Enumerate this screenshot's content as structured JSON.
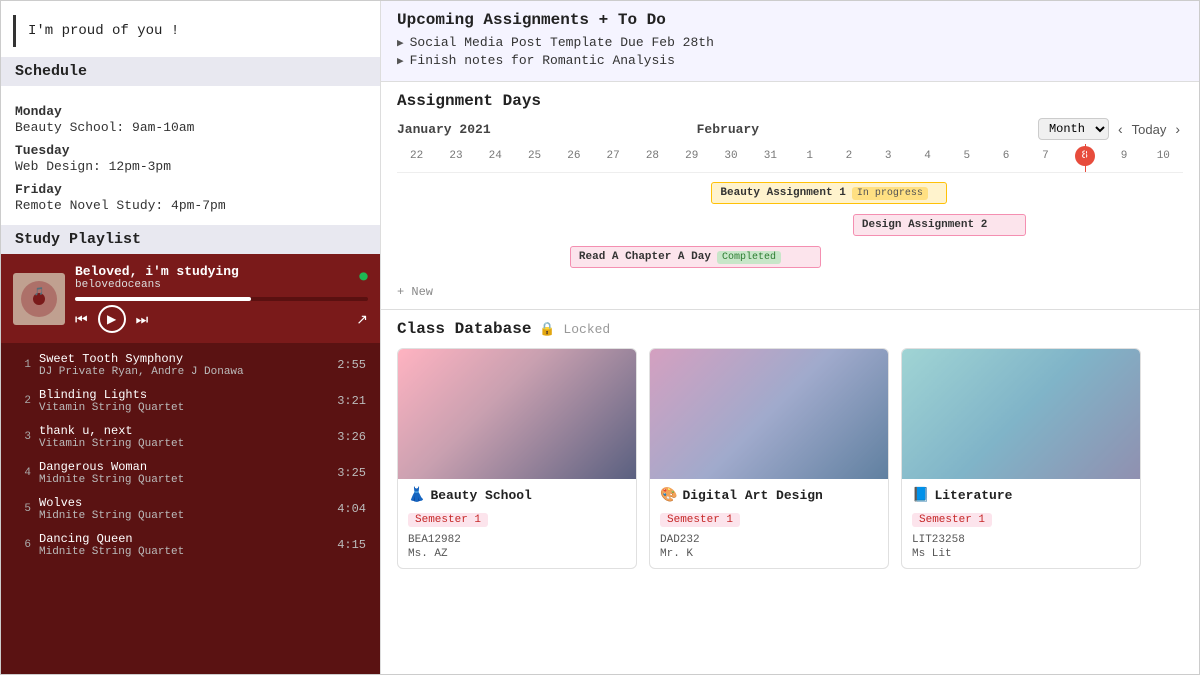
{
  "quote": "I'm proud of you !",
  "left": {
    "schedule_header": "Schedule",
    "schedule_days": [
      {
        "day": "Monday",
        "classes": [
          "Beauty School: 9am-10am"
        ]
      },
      {
        "day": "Tuesday",
        "classes": [
          "Web Design: 12pm-3pm"
        ]
      },
      {
        "day": "Friday",
        "classes": [
          "Remote Novel Study: 4pm-7pm"
        ]
      }
    ],
    "playlist_header": "Study Playlist",
    "now_playing": {
      "title": "Beloved, i'm studying",
      "artist": "belovedoceans"
    },
    "tracks": [
      {
        "num": 1,
        "name": "Sweet Tooth Symphony",
        "artist": "DJ Private Ryan, Andre J Donawa",
        "duration": "2:55"
      },
      {
        "num": 2,
        "name": "Blinding Lights",
        "artist": "Vitamin String Quartet",
        "duration": "3:21"
      },
      {
        "num": 3,
        "name": "thank u, next",
        "artist": "Vitamin String Quartet",
        "duration": "3:26"
      },
      {
        "num": 4,
        "name": "Dangerous Woman",
        "artist": "Midnite String Quartet",
        "duration": "3:25"
      },
      {
        "num": 5,
        "name": "Wolves",
        "artist": "Midnite String Quartet",
        "duration": "4:04"
      },
      {
        "num": 6,
        "name": "Dancing Queen",
        "artist": "Midnite String Quartet",
        "duration": "4:15"
      }
    ]
  },
  "right": {
    "upcoming_title": "Upcoming Assignments + To Do",
    "upcoming_items": [
      "Social Media Post Template Due Feb 28th",
      "Finish notes for Romantic Analysis"
    ],
    "assignment_title": "Assignment Days",
    "calendar": {
      "month_left": "January 2021",
      "month_right": "February",
      "dropdown_label": "Month",
      "today_label": "Today",
      "days": [
        "22",
        "23",
        "24",
        "25",
        "26",
        "27",
        "28",
        "29",
        "30",
        "31",
        "1",
        "2",
        "3",
        "4",
        "5",
        "6",
        "7",
        "8",
        "9",
        "10"
      ],
      "today_index": 17
    },
    "gantt_bars": [
      {
        "label": "Beauty Assignment 1",
        "badge": "In progress",
        "badge_class": "badge-progress",
        "bar_class": "bar-yellow",
        "left_pct": 40,
        "width_pct": 30
      },
      {
        "label": "Design Assignment 2",
        "badge": "",
        "badge_class": "",
        "bar_class": "bar-pink",
        "left_pct": 58,
        "width_pct": 22
      },
      {
        "label": "Read A Chapter A Day",
        "badge": "Completed",
        "badge_class": "badge-completed",
        "bar_class": "bar-pink",
        "left_pct": 22,
        "width_pct": 32
      }
    ],
    "add_new_label": "+ New",
    "class_title": "Class Database",
    "locked_label": "🔒 Locked",
    "classes": [
      {
        "emoji": "👗",
        "name": "Beauty School",
        "semester": "Semester 1",
        "code": "BEA12982",
        "teacher": "Ms. AZ",
        "img_class": "card-img-beauty"
      },
      {
        "emoji": "🎨",
        "name": "Digital Art Design",
        "semester": "Semester 1",
        "code": "DAD232",
        "teacher": "Mr. K",
        "img_class": "card-img-design"
      },
      {
        "emoji": "📘",
        "name": "Literature",
        "semester": "Semester 1",
        "code": "LIT23258",
        "teacher": "Ms Lit",
        "img_class": "card-img-lit"
      }
    ]
  }
}
